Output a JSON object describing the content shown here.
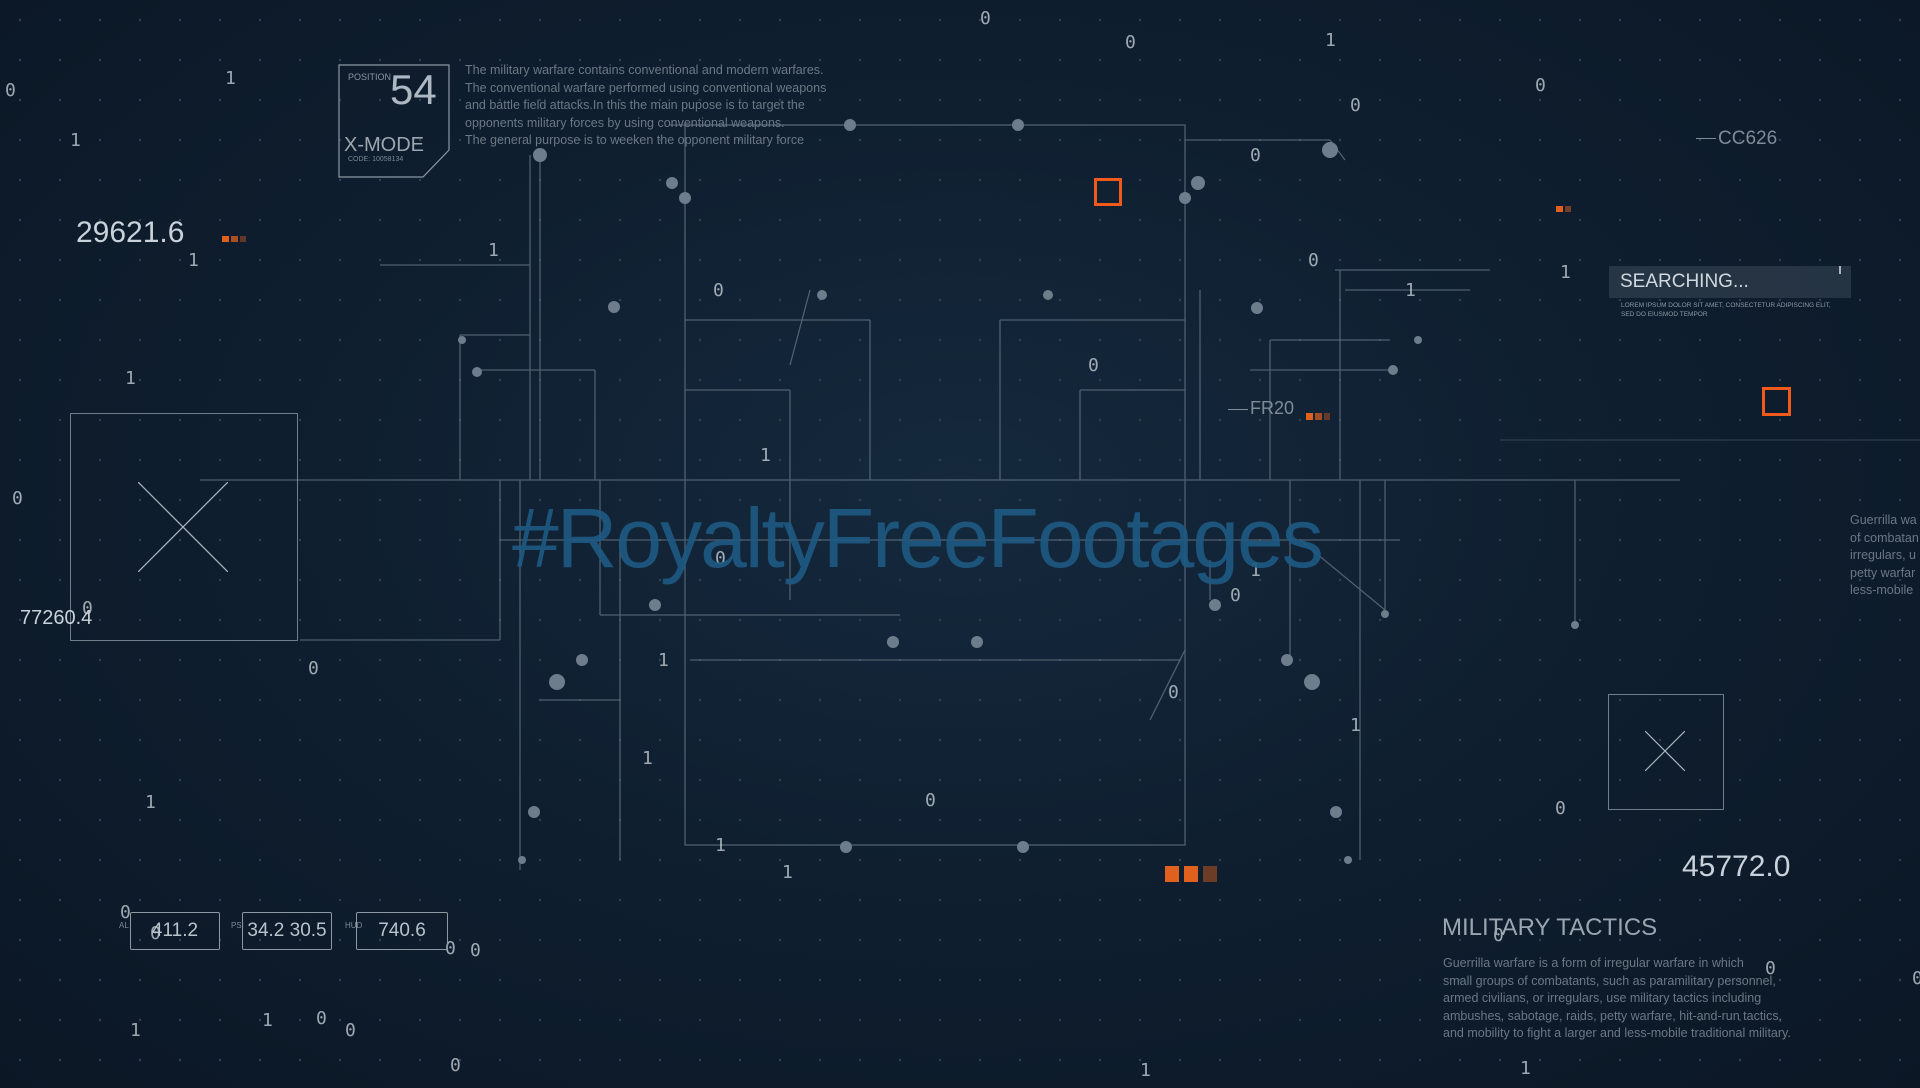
{
  "header_panel": {
    "position_label": "POSITION",
    "position_value": "54",
    "mode": "X-MODE",
    "code": "CODE: 10058134"
  },
  "intro_paragraph": [
    "The military warfare contains conventional and modern warfares.",
    "The conventional warfare performed using conventional weapons",
    "and battle field attacks.In this the main pupose is to target the",
    "opponents military forces by using conventional weapons.",
    "The general purpose is to weeken the opponent military force"
  ],
  "readouts": {
    "left_big": "29621.6",
    "left_small": "77260.4",
    "right_big": "45772.0",
    "cc_tag": "CC626",
    "fr_tag": "FR20"
  },
  "search_panel": {
    "label": "SEARCHING...",
    "subtext": [
      "LOREM IPSUM DOLOR SIT AMET, CONSECTETUR ADIPISCING ELIT,",
      "SED DO EIUSMOD TEMPOR"
    ]
  },
  "bottom_boxes": [
    {
      "prefix": "AL",
      "value": "411.2"
    },
    {
      "prefix": "PSI",
      "value": "34.2 30.5"
    },
    {
      "prefix": "HUD",
      "value": "740.6"
    }
  ],
  "watermark": "#RoyaltyFreeFootages",
  "tactics": {
    "title": "MILITARY TACTICS",
    "lines": [
      "Guerrilla warfare is a form of irregular warfare in which",
      "small groups of combatants, such as paramilitary personnel,",
      "armed civilians, or irregulars, use military tactics including",
      "ambushes, sabotage, raids, petty warfare, hit-and-run tactics,",
      "and mobility to fight a larger and less-mobile traditional military."
    ]
  },
  "edge_snippet": [
    "Guerrilla wa",
    "of combatan",
    "irregulars, u",
    "petty warfar",
    "less-mobile"
  ],
  "colors": {
    "accent": "#f25a1c",
    "line": "#5f6f7e",
    "text": "#c9d2da",
    "watermark": "#1f5f8a"
  }
}
